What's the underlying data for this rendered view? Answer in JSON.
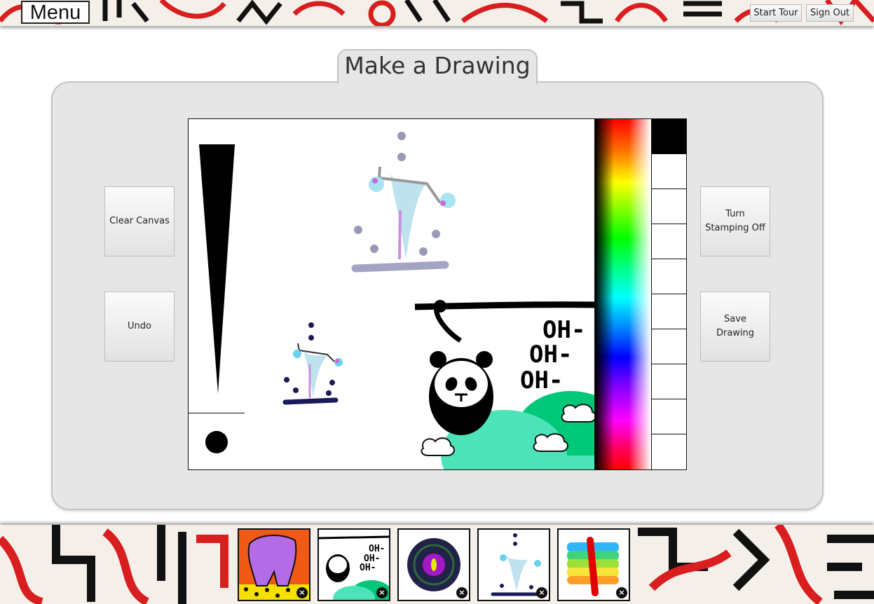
{
  "header": {
    "menu_label": "Menu",
    "start_tour_label": "Start Tour",
    "sign_out_label": "Sign Out"
  },
  "main": {
    "title": "Make a Drawing",
    "buttons": {
      "clear_canvas": "Clear Canvas",
      "undo": "Undo",
      "stamping": "Turn Stamping Off",
      "save_drawing": "Save Drawing"
    }
  },
  "canvas": {
    "text_lines": [
      "OH-",
      "OH-",
      "OH-"
    ]
  },
  "palette": {
    "selected_color": "#000000",
    "swatches": [
      "#000000",
      "#ffffff",
      "#ffffff",
      "#ffffff",
      "#ffffff",
      "#ffffff",
      "#ffffff",
      "#ffffff",
      "#ffffff",
      "#ffffff"
    ]
  },
  "gallery": {
    "thumb_text": "OH-"
  }
}
